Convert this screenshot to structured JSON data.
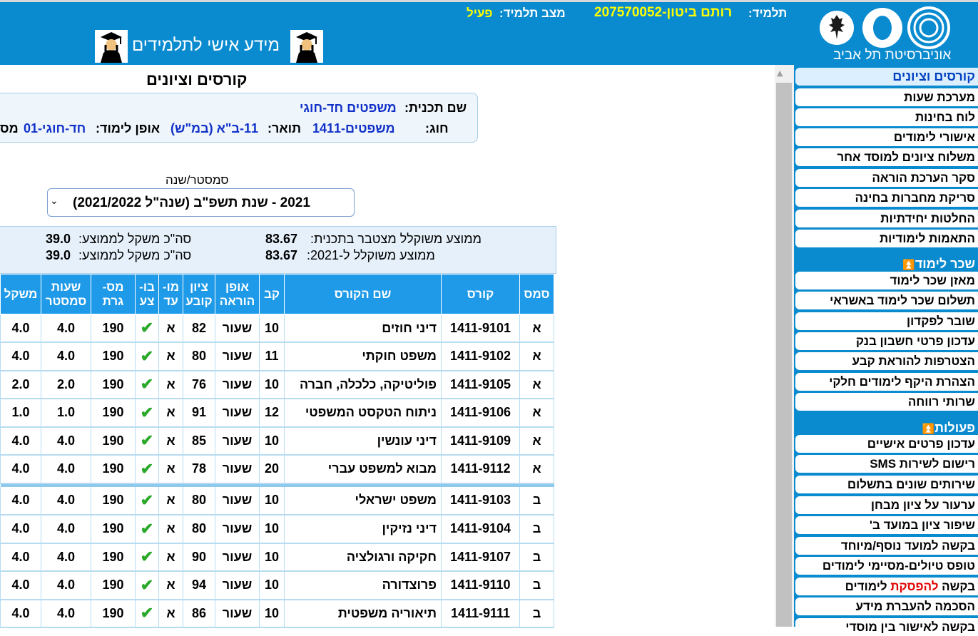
{
  "header": {
    "student_label": "תלמיד:",
    "student_value": "207570052-רותם ביטון",
    "status_label": "מצב תלמיד:",
    "status_value": "פעיל",
    "portal_title": "מידע אישי לתלמידים",
    "logo_text": "אוניברסיטת תל אביב"
  },
  "sidebar": {
    "items_top": [
      "קורסים וציונים",
      "מערכת שעות",
      "לוח בחינות",
      "אישורי לימודים",
      "משלוח ציונים למוסד אחר",
      "סקר הערכת הוראה",
      "סריקת מחברות בחינה",
      "החלטות יחידתיות",
      "התאמות לימודיות"
    ],
    "section_tuition": "שכר לימוד",
    "items_tuition": [
      "מאזן שכר לימוד",
      "תשלום שכר לימוד באשראי",
      "שובר לפקדון",
      "עדכון פרטי חשבון בנק",
      "הצטרפות להוראת קבע",
      "הצהרת היקף לימודים חלקי",
      "שרותי רווחה"
    ],
    "section_actions": "פעולות",
    "items_actions": [
      "עדכון פרטים אישיים",
      "רישום לשירות SMS",
      "שירותים שונים בתשלום",
      "ערעור על ציון מבחן",
      "שיפור ציון במועד ב'",
      "בקשה למועד נוסף/מיוחד",
      "טופס טיולים-מסיימי לימודים"
    ],
    "stop_request_pre": "בקשה ",
    "stop_request_red": "להפסקת",
    "stop_request_post": " לימודים",
    "item_last": "הסכמה להעברת מידע",
    "item_cut": "בקשה לאישור בין מוסדי"
  },
  "main": {
    "title": "קורסים וציונים",
    "program_label": "שם תכנית:",
    "program_value": "משפטים חד-חוגי",
    "track_label": "חוג:",
    "track_value": "1411-משפטים",
    "degree_label": "תואר:",
    "degree_value": "11-ב\"א (במ\"ש)",
    "mode_label": "אופן לימוד:",
    "mode_value": "01-חד-חוגי",
    "mode_cut": "מס",
    "semester_label": "סמסטר/שנה",
    "semester_value": "2021 - שנת תשפ\"ב   (שנה\"ל 2021/2022)",
    "avg_program_label": "ממוצע משוקלל מצטבר בתכנית:",
    "avg_program_value": "83.67",
    "avg_year_label": "ממוצע משוקלל ל-2021:",
    "avg_year_value": "83.67",
    "weight_label": "סה\"כ משקל לממוצע:",
    "weight_value_1": "39.0",
    "weight_value_2": "39.0"
  },
  "table": {
    "headers": [
      "סמס",
      "קורס",
      "שם הקורס",
      "קב",
      "אופן הוראה",
      "ציון קובע",
      "מו- עד",
      "בו- צע",
      "מס- גרת",
      "שעות סמסטר",
      "משקל"
    ],
    "rows_a": [
      [
        "א",
        "1411-9101",
        "דיני חוזים",
        "10",
        "שעור",
        "82",
        "א",
        "190",
        "4.0",
        "4.0"
      ],
      [
        "א",
        "1411-9102",
        "משפט חוקתי",
        "11",
        "שעור",
        "80",
        "א",
        "190",
        "4.0",
        "4.0"
      ],
      [
        "א",
        "1411-9105",
        "פוליטיקה, כלכלה, חברה",
        "10",
        "שעור",
        "76",
        "א",
        "190",
        "2.0",
        "2.0"
      ],
      [
        "א",
        "1411-9106",
        "ניתוח הטקסט המשפטי",
        "12",
        "שעור",
        "91",
        "א",
        "190",
        "1.0",
        "1.0"
      ],
      [
        "א",
        "1411-9109",
        "דיני עונשין",
        "10",
        "שעור",
        "85",
        "א",
        "190",
        "4.0",
        "4.0"
      ],
      [
        "א",
        "1411-9112",
        "מבוא למשפט עברי",
        "20",
        "שעור",
        "78",
        "א",
        "190",
        "4.0",
        "4.0"
      ]
    ],
    "rows_b": [
      [
        "ב",
        "1411-9103",
        "משפט ישראלי",
        "10",
        "שעור",
        "80",
        "א",
        "190",
        "4.0",
        "4.0"
      ],
      [
        "ב",
        "1411-9104",
        "דיני נזיקין",
        "10",
        "שעור",
        "80",
        "א",
        "190",
        "4.0",
        "4.0"
      ],
      [
        "ב",
        "1411-9107",
        "חקיקה ורגולציה",
        "10",
        "שעור",
        "90",
        "א",
        "190",
        "4.0",
        "4.0"
      ],
      [
        "ב",
        "1411-9110",
        "פרוצדורה",
        "10",
        "שעור",
        "94",
        "א",
        "190",
        "4.0",
        "4.0"
      ],
      [
        "ב",
        "1411-9111",
        "תיאוריה משפטית",
        "10",
        "שעור",
        "86",
        "א",
        "190",
        "4.0",
        "4.0"
      ]
    ]
  },
  "colors": {
    "header_bg": "#0a8bd0",
    "accent_yellow": "#ffff00",
    "table_header_bg": "#1e9ae8"
  },
  "icons": [
    "graduate-icon",
    "check-icon",
    "chevron-down-icon",
    "double-chevron-up-icon",
    "scroll-up-icon"
  ]
}
